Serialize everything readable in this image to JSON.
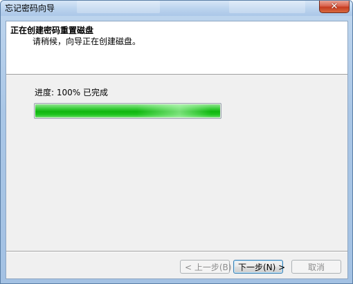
{
  "window": {
    "title": "忘记密码向导",
    "close_glyph": "✕"
  },
  "header": {
    "title": "正在创建密码重置磁盘",
    "subtitle": "请稍候，向导正在创建磁盘。"
  },
  "progress": {
    "label": "进度: 100% 已完成",
    "fraction": 1.0
  },
  "buttons": {
    "back_label": "< 上一步(B)",
    "next_label": "下一步(N) >",
    "cancel_label": "取消"
  },
  "colors": {
    "progress_green": "#1bbf1b",
    "close_red": "#c63c22",
    "window_frame": "#a9c6e6"
  },
  "icons": {
    "close": "close-icon"
  }
}
